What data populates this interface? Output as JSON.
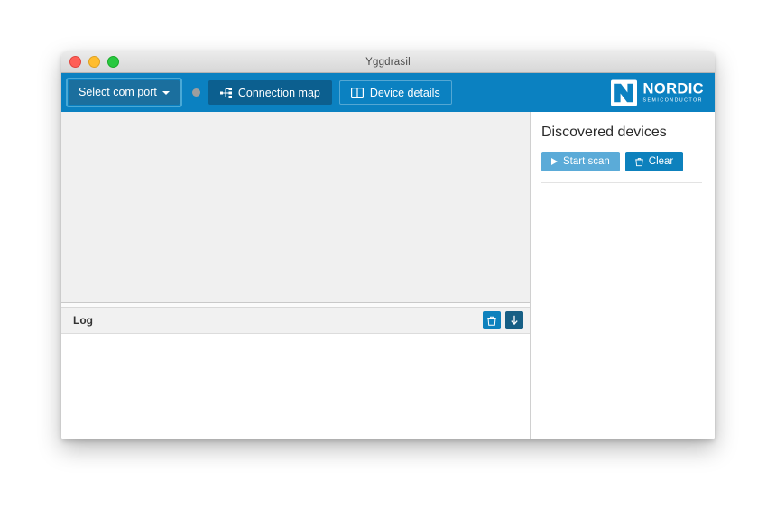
{
  "window": {
    "title": "Yggdrasil",
    "traffic_lights": [
      {
        "name": "close",
        "color": "#ff5f57"
      },
      {
        "name": "minimize",
        "color": "#ffbd2e"
      },
      {
        "name": "maximize",
        "color": "#28c840"
      }
    ]
  },
  "toolbar": {
    "background": "#0b81c1",
    "com_port_label": "Select com port",
    "com_port_icon": "chevron-down-icon",
    "status_dot_color": "#9e9e9e",
    "buttons": [
      {
        "label": "Connection map",
        "icon": "sitemap-icon",
        "active": true
      },
      {
        "label": "Device details",
        "icon": "columns-icon",
        "active": false
      }
    ],
    "logo": {
      "name": "NORDIC",
      "subtitle": "SEMICONDUCTOR",
      "icon": "nordic-logo-mark"
    }
  },
  "connection_map": {
    "background": "#f0f0f0",
    "content": ""
  },
  "log": {
    "title": "Log",
    "buttons": [
      {
        "name": "clear-log-button",
        "icon": "trash-icon",
        "color": "#0d81bd"
      },
      {
        "name": "scroll-log-button",
        "icon": "arrow-down-icon",
        "color": "#175f85"
      }
    ],
    "entries": []
  },
  "discovered_devices": {
    "heading": "Discovered devices",
    "buttons": [
      {
        "label": "Start scan",
        "icon": "play-icon",
        "color": "#5babd8"
      },
      {
        "label": "Clear",
        "icon": "trash-icon",
        "color": "#0d81bd"
      }
    ],
    "devices": []
  }
}
